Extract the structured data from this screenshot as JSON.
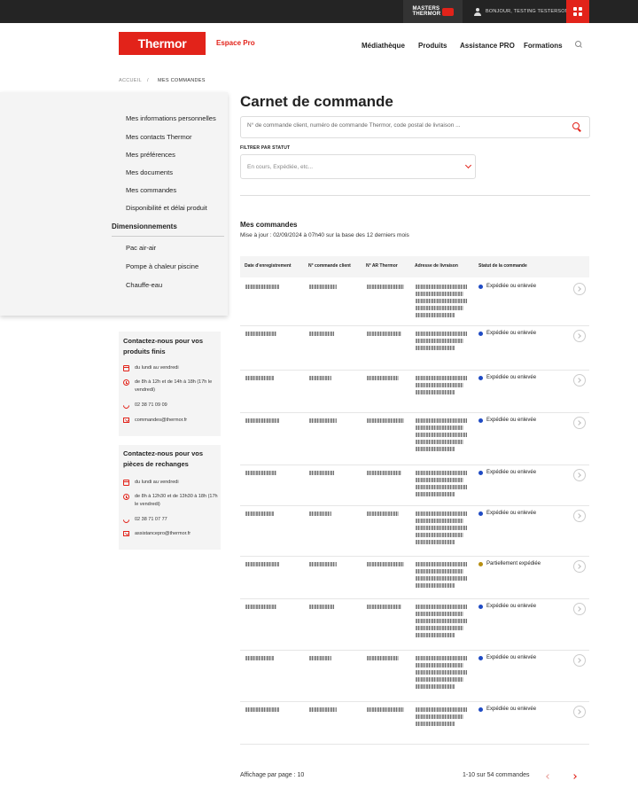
{
  "topbar": {
    "masters_label": "MASTERS THERMOR",
    "user_label": "BONJOUR, TESTING TESTERSON"
  },
  "header": {
    "logo_text": "Thermor",
    "espace_label": "Espace Pro",
    "nav": [
      "Médiathèque",
      "Produits",
      "Assistance PRO",
      "Formations"
    ]
  },
  "breadcrumb": {
    "home": "ACCUEIL",
    "separator": "/",
    "current": "MES COMMANDES"
  },
  "sidebar": {
    "account_links": [
      "Mes informations personnelles",
      "Mes contacts Thermor",
      "Mes préférences",
      "Mes documents",
      "Mes commandes",
      "Disponibilité et délai produit"
    ],
    "section_title": "Dimensionnements",
    "sizing_links": [
      "Pac air-air",
      "Pompe à chaleur piscine",
      "Chauffe-eau"
    ]
  },
  "contact_finished": {
    "title": "Contactez-nous pour vos produits finis",
    "days": "du lundi au vendredi",
    "hours": "de 8h à 12h et de 14h à 18h (17h le vendredi)",
    "phone": "02 38 71 09 09",
    "email": "commandes@thermor.fr"
  },
  "contact_parts": {
    "title": "Contactez-nous pour vos pièces de rechanges",
    "days": "du lundi au vendredi",
    "hours": "de 8h à 12h30 et de 13h30 à 18h (17h le vendredi)",
    "phone": "02 38 71 07 77",
    "email": "assistancepro@thermor.fr"
  },
  "main": {
    "title": "Carnet de commande",
    "search_placeholder": "N° de commande client, numéro de commande Thermor, code postal de livraison ...",
    "filter_label": "FILTRER PAR STATUT",
    "filter_placeholder": "En cours, Expédiée, etc...",
    "orders_title": "Mes commandes",
    "orders_subtitle": "Mise à jour : 02/09/2024 à 07h40 sur la base des 12 derniers mois"
  },
  "table": {
    "headers": [
      "Date d'enregistrement",
      "N° commande client",
      "N° AR Thermor",
      "Adresse de livraison",
      "Statut de la commande"
    ],
    "rows": [
      {
        "status": "Expédiée ou enlevée",
        "status_color": "#1f4bc4"
      },
      {
        "status": "Expédiée ou enlevée",
        "status_color": "#1f4bc4"
      },
      {
        "status": "Expédiée ou enlevée",
        "status_color": "#1f4bc4"
      },
      {
        "status": "Expédiée ou enlevée",
        "status_color": "#1f4bc4"
      },
      {
        "status": "Expédiée ou enlevée",
        "status_color": "#1f4bc4"
      },
      {
        "status": "Expédiée ou enlevée",
        "status_color": "#1f4bc4"
      },
      {
        "status": "Partiellement expédiée",
        "status_color": "#b78f12"
      },
      {
        "status": "Expédiée ou enlevée",
        "status_color": "#1f4bc4"
      },
      {
        "status": "Expédiée ou enlevée",
        "status_color": "#1f4bc4"
      },
      {
        "status": "Expédiée ou enlevée",
        "status_color": "#1f4bc4"
      }
    ]
  },
  "pagination": {
    "per_page": "Affichage par page : 10",
    "count": "1-10 sur 54 commandes"
  },
  "colors": {
    "brand_red": "#e2231a",
    "topbar": "#242424",
    "panel": "#f4f4f4"
  }
}
